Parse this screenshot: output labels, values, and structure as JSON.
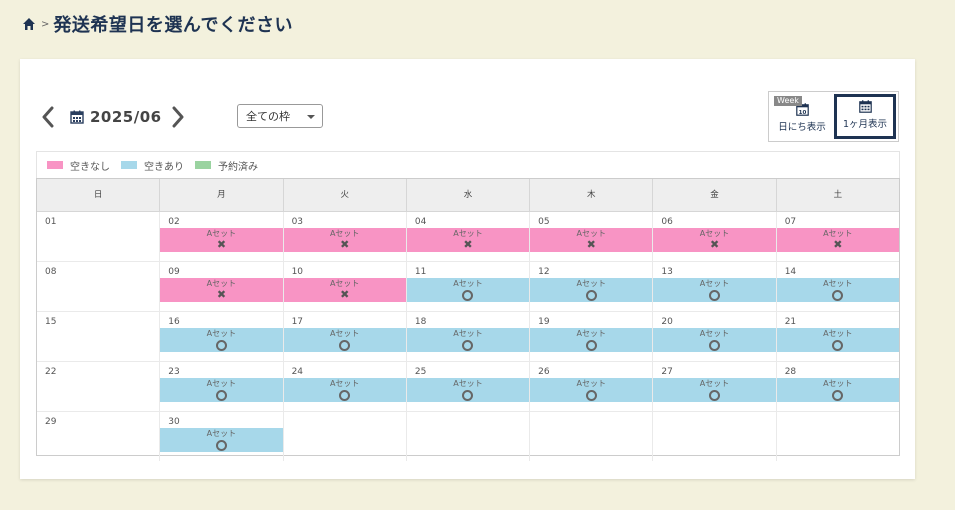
{
  "header": {
    "breadcrumb_sep": ">",
    "title": "発送希望日を選んでください"
  },
  "toolbar": {
    "month": "2025/06",
    "frame_select": "全ての枠",
    "week_tag": "Week",
    "day_view_label": "日にち表示",
    "day_view_icon_num": "10",
    "month_view_label": "1ヶ月表示"
  },
  "legend": [
    {
      "label": "空きなし",
      "color": "#f894c4"
    },
    {
      "label": "空きあり",
      "color": "#a7d8ea"
    },
    {
      "label": "予約済み",
      "color": "#9ad3a0"
    }
  ],
  "weekdays": [
    "日",
    "月",
    "火",
    "水",
    "木",
    "金",
    "土"
  ],
  "weeks": [
    [
      {
        "day": "01",
        "status": "none"
      },
      {
        "day": "02",
        "status": "full",
        "label": "Aセット",
        "mark": "✖"
      },
      {
        "day": "03",
        "status": "full",
        "label": "Aセット",
        "mark": "✖"
      },
      {
        "day": "04",
        "status": "full",
        "label": "Aセット",
        "mark": "✖"
      },
      {
        "day": "05",
        "status": "full",
        "label": "Aセット",
        "mark": "✖"
      },
      {
        "day": "06",
        "status": "full",
        "label": "Aセット",
        "mark": "✖"
      },
      {
        "day": "07",
        "status": "full",
        "label": "Aセット",
        "mark": "✖"
      }
    ],
    [
      {
        "day": "08",
        "status": "none"
      },
      {
        "day": "09",
        "status": "full",
        "label": "Aセット",
        "mark": "✖"
      },
      {
        "day": "10",
        "status": "full",
        "label": "Aセット",
        "mark": "✖"
      },
      {
        "day": "11",
        "status": "open",
        "label": "Aセット",
        "mark": "○"
      },
      {
        "day": "12",
        "status": "open",
        "label": "Aセット",
        "mark": "○"
      },
      {
        "day": "13",
        "status": "open",
        "label": "Aセット",
        "mark": "○"
      },
      {
        "day": "14",
        "status": "open",
        "label": "Aセット",
        "mark": "○"
      }
    ],
    [
      {
        "day": "15",
        "status": "none"
      },
      {
        "day": "16",
        "status": "open",
        "label": "Aセット",
        "mark": "○"
      },
      {
        "day": "17",
        "status": "open",
        "label": "Aセット",
        "mark": "○"
      },
      {
        "day": "18",
        "status": "open",
        "label": "Aセット",
        "mark": "○"
      },
      {
        "day": "19",
        "status": "open",
        "label": "Aセット",
        "mark": "○"
      },
      {
        "day": "20",
        "status": "open",
        "label": "Aセット",
        "mark": "○"
      },
      {
        "day": "21",
        "status": "open",
        "label": "Aセット",
        "mark": "○"
      }
    ],
    [
      {
        "day": "22",
        "status": "none"
      },
      {
        "day": "23",
        "status": "open",
        "label": "Aセット",
        "mark": "○"
      },
      {
        "day": "24",
        "status": "open",
        "label": "Aセット",
        "mark": "○"
      },
      {
        "day": "25",
        "status": "open",
        "label": "Aセット",
        "mark": "○"
      },
      {
        "day": "26",
        "status": "open",
        "label": "Aセット",
        "mark": "○"
      },
      {
        "day": "27",
        "status": "open",
        "label": "Aセット",
        "mark": "○"
      },
      {
        "day": "28",
        "status": "open",
        "label": "Aセット",
        "mark": "○"
      }
    ],
    [
      {
        "day": "29",
        "status": "none"
      },
      {
        "day": "30",
        "status": "open",
        "label": "Aセット",
        "mark": "○"
      },
      {
        "day": "",
        "status": "empty"
      },
      {
        "day": "",
        "status": "empty"
      },
      {
        "day": "",
        "status": "empty"
      },
      {
        "day": "",
        "status": "empty"
      },
      {
        "day": "",
        "status": "empty"
      }
    ]
  ]
}
